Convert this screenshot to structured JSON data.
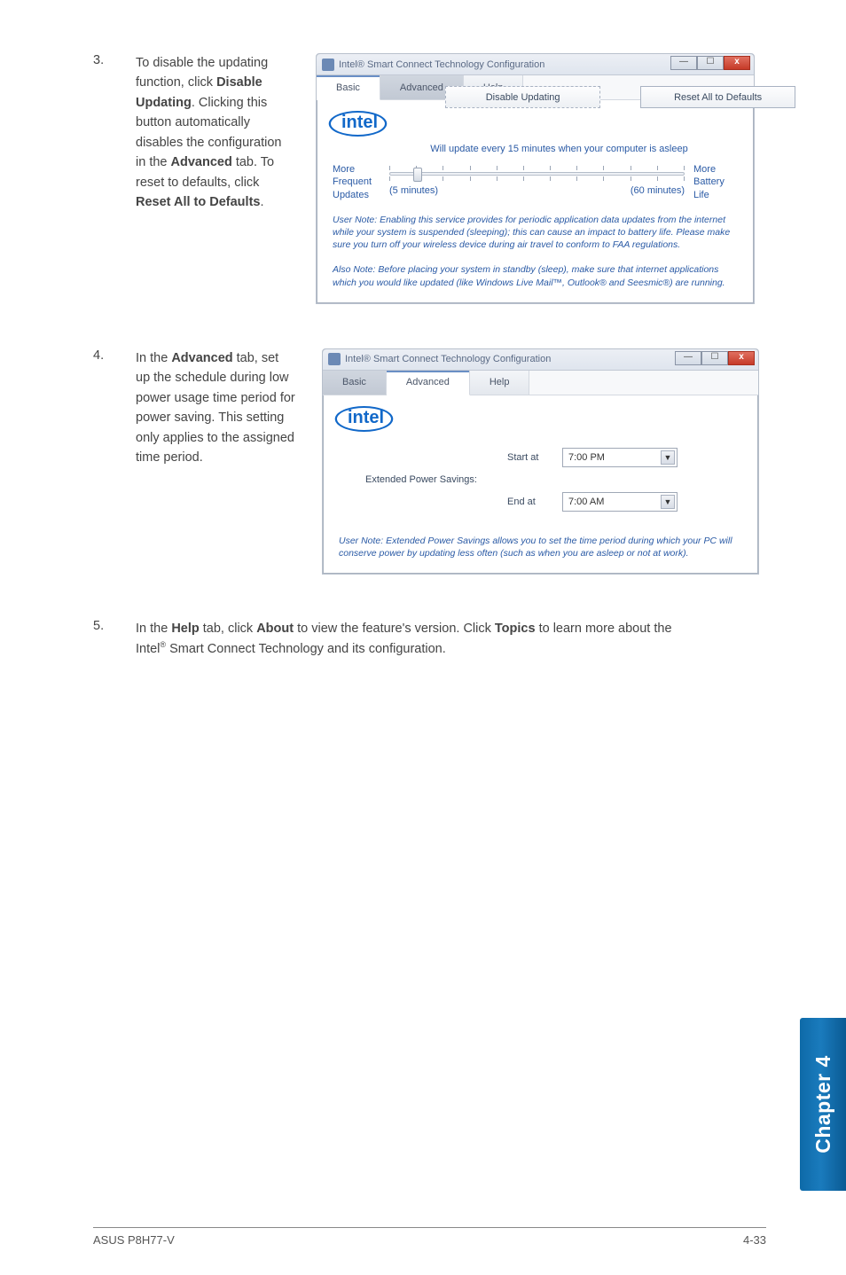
{
  "steps": {
    "s3": {
      "num": "3.",
      "text_parts": [
        "To disable the updating function, click ",
        "Disable Updating",
        ". Clicking this button automatically disables the configuration in the ",
        "Advanced",
        " tab. To reset to defaults, click ",
        "Reset All to Defaults",
        "."
      ]
    },
    "s4": {
      "num": "4.",
      "text_parts": [
        "In the ",
        "Advanced",
        " tab, set up the schedule during low power usage time period for power saving. This setting only applies to the assigned time period."
      ]
    },
    "s5": {
      "num": "5.",
      "text_parts": [
        "In the ",
        "Help",
        " tab, click ",
        "About",
        " to view the feature's version. Click ",
        "Topics",
        " to learn more about the Intel",
        "®",
        " Smart Connect Technology and its configuration."
      ]
    }
  },
  "window": {
    "title": "Intel® Smart Connect Technology Configuration",
    "tabs": {
      "basic": "Basic",
      "advanced": "Advanced",
      "help": "Help"
    },
    "logo": "intel"
  },
  "win1": {
    "btn_disable": "Disable Updating",
    "btn_reset": "Reset All to Defaults",
    "status": "Will update every 15 minutes when your computer is asleep",
    "left_label_l1": "More",
    "left_label_l2": "Frequent",
    "left_label_l3": "Updates",
    "right_label_l1": "More",
    "right_label_l2": "Battery",
    "right_label_l3": "Life",
    "min": "(5 minutes)",
    "max": "(60 minutes)",
    "note1": "User Note: Enabling this service provides for periodic application data updates from the internet while your system is suspended (sleeping); this can cause an impact to battery life. Please make sure you turn off your wireless device during air travel to conform to FAA regulations.",
    "note2": "Also Note: Before placing your system in standby (sleep), make sure that internet applications which you would like updated (like Windows Live Mail™, Outlook® and Seesmic®) are running."
  },
  "win2": {
    "eps_label": "Extended Power Savings:",
    "start_label": "Start at",
    "start_value": "7:00 PM",
    "end_label": "End at",
    "end_value": "7:00 AM",
    "note": "User Note: Extended Power Savings allows you to set the time period during which your PC will conserve power by updating less often (such as when you are asleep or not at work)."
  },
  "chapter_tab": "Chapter 4",
  "footer": {
    "left": "ASUS P8H77-V",
    "right": "4-33"
  },
  "win_controls": {
    "min": "—",
    "max": "☐",
    "close": "x"
  }
}
